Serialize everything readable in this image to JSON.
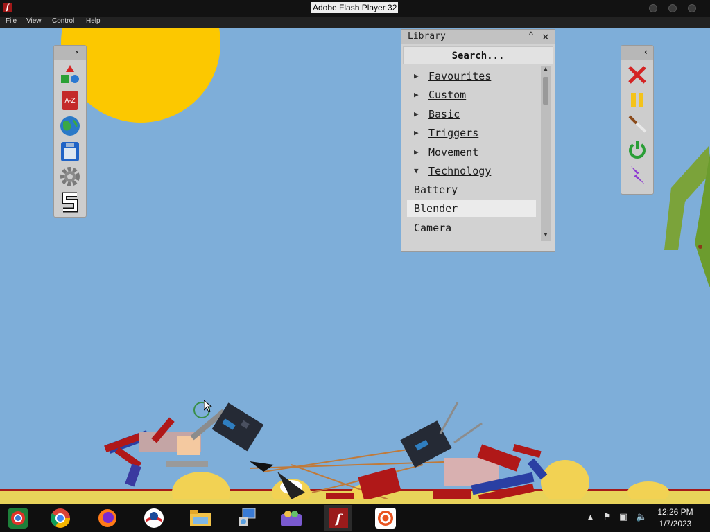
{
  "window": {
    "title": "Adobe Flash Player 32"
  },
  "menu": {
    "items": [
      "File",
      "View",
      "Control",
      "Help"
    ]
  },
  "library": {
    "title": "Library",
    "search_placeholder": "Search...",
    "categories": [
      {
        "label": "Favourites",
        "expanded": false
      },
      {
        "label": "Custom ",
        "expanded": false
      },
      {
        "label": "Basic",
        "expanded": false
      },
      {
        "label": "Triggers",
        "expanded": false
      },
      {
        "label": "Movement ",
        "expanded": false
      },
      {
        "label": "Technology",
        "expanded": true
      }
    ],
    "items": [
      {
        "label": "Battery",
        "selected": false
      },
      {
        "label": "Blender",
        "selected": true
      },
      {
        "label": "Camera",
        "selected": false
      }
    ]
  },
  "left_toolbar": {
    "tools": [
      "shapes-icon",
      "text-icon",
      "world-icon",
      "save-icon",
      "settings-icon",
      "snap-icon"
    ]
  },
  "right_toolbar": {
    "tools": [
      "delete-icon",
      "pause-icon",
      "knife-icon",
      "power-icon",
      "lightning-icon"
    ]
  },
  "taskbar": {
    "apps": [
      "chrome-os-icon",
      "chrome-icon",
      "firefox-icon",
      "obama-icon",
      "file-explorer-icon",
      "control-panel-icon",
      "network-people-icon",
      "flash-icon",
      "ubuntu-icon"
    ],
    "time": "12:26 PM",
    "date": "1/7/2023"
  },
  "colors": {
    "sky": "#7eaed9",
    "sun": "#fcc800",
    "ground": "#e8d35a",
    "blood": "#a51a1a"
  }
}
